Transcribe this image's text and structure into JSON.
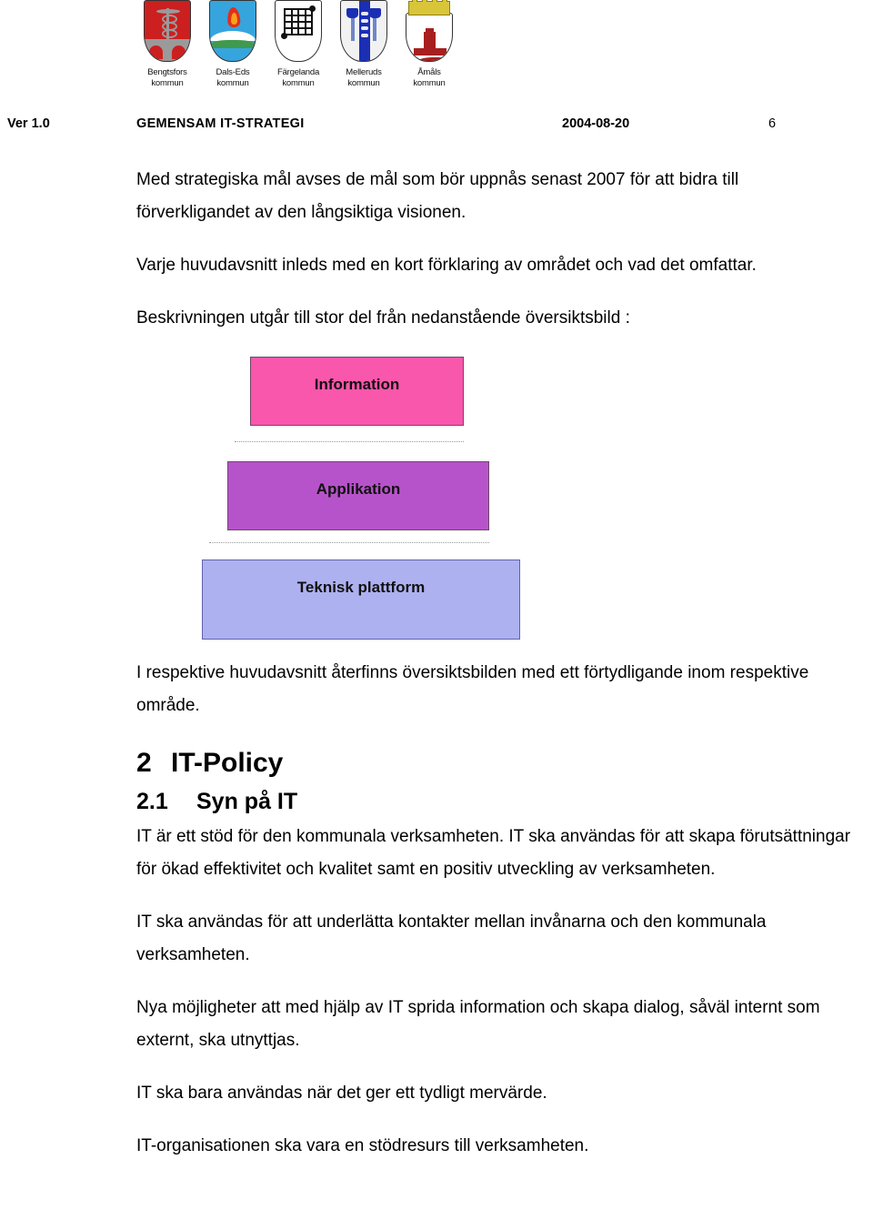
{
  "crests": [
    {
      "name": "bengtsfors",
      "line1": "Bengtsfors",
      "line2": "kommun"
    },
    {
      "name": "dals-ed",
      "line1": "Dals-Eds",
      "line2": "kommun"
    },
    {
      "name": "fargelanda",
      "line1": "Färgelanda",
      "line2": "kommun"
    },
    {
      "name": "melleruds",
      "line1": "Melleruds",
      "line2": "kommun"
    },
    {
      "name": "amals",
      "line1": "Åmåls",
      "line2": "kommun"
    }
  ],
  "header": {
    "version": "Ver 1.0",
    "title": "GEMENSAM IT-STRATEGI",
    "date": "2004-08-20",
    "page": "6"
  },
  "body": {
    "p1": "Med strategiska mål avses de mål som bör uppnås senast 2007 för att bidra till förverkligandet av den långsiktiga visionen.",
    "p2": "Varje huvudavsnitt inleds med en kort förklaring av området och vad det omfattar.",
    "p3": "Beskrivningen utgår till stor del från nedanstående översiktsbild :",
    "p4": "I respektive huvudavsnitt återfinns översiktsbilden med ett förtydligande inom respektive område.",
    "p5": "IT är ett stöd för den kommunala verksamheten. IT ska användas för att skapa förutsättningar för ökad effektivitet och kvalitet samt en positiv utveckling av verksamheten.",
    "p6": "IT ska användas för att underlätta kontakter mellan invånarna och den kommunala verksamheten.",
    "p7": "Nya möjligheter att med hjälp av IT sprida information och skapa dialog, såväl internt som externt, ska utnyttjas.",
    "p8": "IT ska bara användas när det ger ett tydligt mervärde.",
    "p9": "IT-organisationen ska vara en stödresurs till verksamheten."
  },
  "headings": {
    "h2_num": "2",
    "h2_text": "IT-Policy",
    "h21_num": "2.1",
    "h21_text": "Syn på IT"
  },
  "diagram": {
    "layers": [
      {
        "label": "Information",
        "color": "#f957ab"
      },
      {
        "label": "Applikation",
        "color": "#b753ca"
      },
      {
        "label": "Teknisk plattform",
        "color": "#aeb1f0"
      }
    ]
  }
}
